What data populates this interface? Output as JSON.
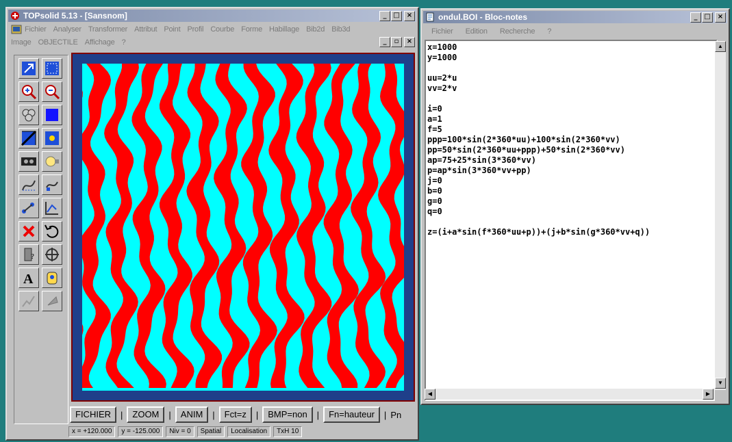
{
  "topsolid": {
    "title": "TOPsolid 5.13 - [Sansnom]",
    "menu1": [
      "Fichier",
      "Analyser",
      "Transformer",
      "Attribut",
      "Point",
      "Profil",
      "Courbe",
      "Forme",
      "Habillage",
      "Bib2d",
      "Bib3d"
    ],
    "menu2": [
      "Image",
      "OBJECTILE",
      "Affichage",
      "?"
    ],
    "bottom_buttons": [
      "FICHIER",
      "ZOOM",
      "ANIM",
      "Fct=z",
      "BMP=non",
      "Fn=hauteur",
      "Pn"
    ],
    "status": [
      "x = +120.000",
      "y = -125.000",
      "Niv = 0",
      "Spatial",
      "Localisation",
      "TxH 10"
    ],
    "tools": [
      "arrow-icon",
      "select-square-icon",
      "zoom-in-icon",
      "zoom-out-icon",
      "pan-icon",
      "fill-square-icon",
      "hide-icon",
      "image-icon",
      "cassette-icon",
      "light-icon",
      "curve-icon",
      "tweak-icon",
      "node-icon",
      "graph-icon",
      "delete-icon",
      "undo-icon",
      "door-icon",
      "target-icon",
      "text-icon",
      "hand-icon",
      "grayed-icon",
      "disabled-icon"
    ],
    "colors": {
      "stripe_a": "#ff0000",
      "stripe_b": "#00ffff",
      "frame": "#1f3f8a"
    }
  },
  "notepad": {
    "title": "ondul.BOI - Bloc-notes",
    "menu": [
      "Fichier",
      "Edition",
      "Recherche",
      "?"
    ],
    "lines": [
      "x=1000",
      "y=1000",
      "",
      "uu=2*u",
      "vv=2*v",
      "",
      "i=0",
      "a=1",
      "f=5",
      "ppp=100*sin(2*360*uu)+100*sin(2*360*vv)",
      "pp=50*sin(2*360*uu+ppp)+50*sin(2*360*vv)",
      "ap=75+25*sin(3*360*vv)",
      "p=ap*sin(3*360*vv+pp)",
      "j=0",
      "b=0",
      "g=0",
      "q=0",
      "",
      "z=(i+a*sin(f*360*uu+p))+(j+b*sin(g*360*vv+q))"
    ]
  }
}
